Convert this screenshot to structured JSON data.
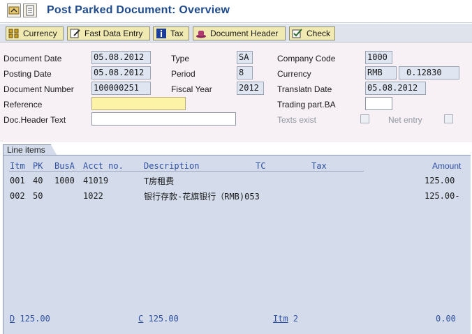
{
  "window": {
    "title": "Post Parked Document: Overview"
  },
  "toolbar": {
    "currency": "Currency",
    "fast_data_entry": "Fast Data Entry",
    "tax": "Tax",
    "document_header": "Document Header",
    "check": "Check"
  },
  "header": {
    "document_date": {
      "label": "Document Date",
      "value": "05.08.2012"
    },
    "posting_date": {
      "label": "Posting Date",
      "value": "05.08.2012"
    },
    "document_number": {
      "label": "Document Number",
      "value": "100000251"
    },
    "reference": {
      "label": "Reference",
      "value": ""
    },
    "doc_header_text": {
      "label": "Doc.Header Text",
      "value": ""
    },
    "type": {
      "label": "Type",
      "value": "SA"
    },
    "period": {
      "label": "Period",
      "value": "8"
    },
    "fiscal_year": {
      "label": "Fiscal Year",
      "value": "2012"
    },
    "company_code": {
      "label": "Company Code",
      "value": "1000"
    },
    "currency": {
      "label": "Currency",
      "value": "RMB",
      "rate": "0.12830"
    },
    "translation_date": {
      "label": "Translatn Date",
      "value": "05.08.2012"
    },
    "trading_partner": {
      "label": "Trading part.BA",
      "value": ""
    },
    "texts_exist": {
      "label": "Texts exist",
      "checked": false
    },
    "net_entry": {
      "label": "Net entry",
      "checked": false
    }
  },
  "line_items": {
    "tab_label": "Line items",
    "columns": {
      "itm": "Itm",
      "pk": "PK",
      "busa": "BusA",
      "acct": "Acct no.",
      "description": "Description",
      "tc": "TC",
      "tax": "Tax",
      "amount": "Amount"
    },
    "rows": [
      {
        "itm": "001",
        "pk": "40",
        "busa": "1000",
        "acct": "41019",
        "description": "T房租费",
        "amount": "125.00"
      },
      {
        "itm": "002",
        "pk": "50",
        "busa": "",
        "acct": "1022",
        "description": "银行存款-花旗银行（RMB)053",
        "amount": "125.00-"
      }
    ],
    "footer": {
      "debit_label": "D",
      "debit_value": "125.00",
      "credit_label": "C",
      "credit_value": "125.00",
      "items_label": "Itm",
      "items_value": "2",
      "balance": "0.00"
    }
  }
}
